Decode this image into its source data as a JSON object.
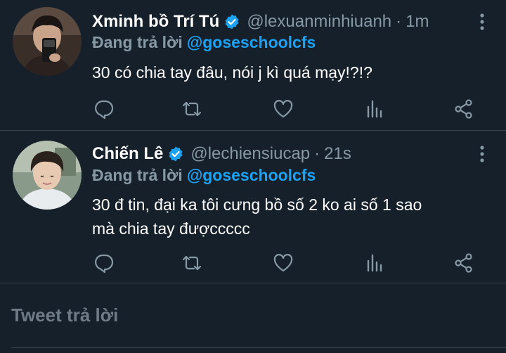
{
  "tweets": [
    {
      "name": "Xminh bồ Trí Tú",
      "handle": "@lexuanminhiuanh",
      "separator": "·",
      "time": "1m",
      "replying_label": "Đang trả lời",
      "replying_to": "@goseschoolcfs",
      "text": "30 có chia tay đâu, nói j kì quá mạy!?!?",
      "verified": true
    },
    {
      "name": "Chiến Lê",
      "handle": "@lechiensiucap",
      "separator": "·",
      "time": "21s",
      "replying_label": "Đang trả lời",
      "replying_to": "@goseschoolcfs",
      "text_lines": [
        "30 đ tin, đại ka tôi cưng bồ số 2 ko ai số 1 sao",
        "mà chia tay đượccccc"
      ],
      "verified": true
    }
  ],
  "compose": {
    "placeholder": "Tweet trả lời"
  },
  "icons": [
    "reply-icon",
    "retweet-icon",
    "like-icon",
    "analytics-icon",
    "share-icon",
    "more-icon",
    "verified-icon"
  ],
  "colors": {
    "background": "#15202b",
    "accent": "#1da1f2",
    "muted": "#8899a6",
    "divider": "#38444d"
  }
}
